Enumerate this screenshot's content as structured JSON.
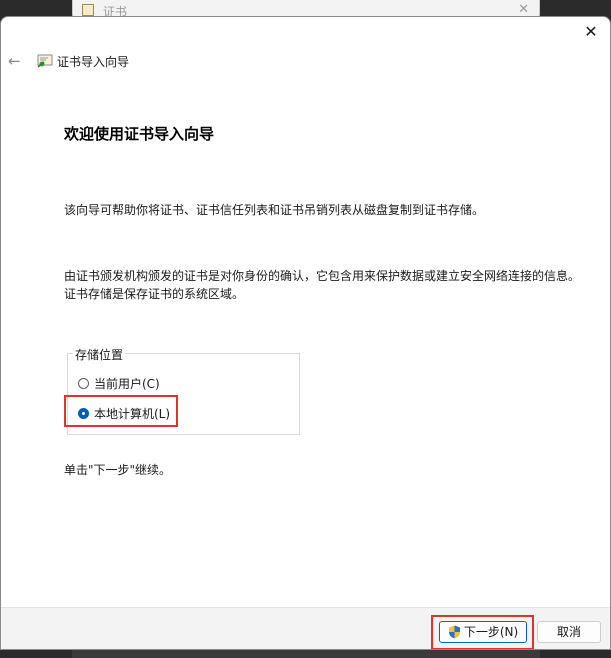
{
  "background_window": {
    "title": "证书"
  },
  "dialog": {
    "close_glyph": "✕",
    "back_glyph": "←",
    "wizard_title": "证书导入向导",
    "heading": "欢迎使用证书导入向导",
    "paragraph1": "该向导可帮助你将证书、证书信任列表和证书吊销列表从磁盘复制到证书存储。",
    "paragraph2": "由证书颁发机构颁发的证书是对你身份的确认，它包含用来保护数据或建立安全网络连接的信息。证书存储是保存证书的系统区域。",
    "store_location": {
      "legend": "存储位置",
      "options": [
        {
          "label": "当前用户(C)",
          "selected": false
        },
        {
          "label": "本地计算机(L)",
          "selected": true
        }
      ]
    },
    "continue_text": "单击\"下一步\"继续。",
    "buttons": {
      "next": "下一步(N)",
      "cancel": "取消"
    }
  },
  "colors": {
    "accent": "#005fb8",
    "highlight": "#e0332f"
  },
  "icons": {
    "cert": "certificate-icon",
    "shield": "uac-shield-icon"
  }
}
